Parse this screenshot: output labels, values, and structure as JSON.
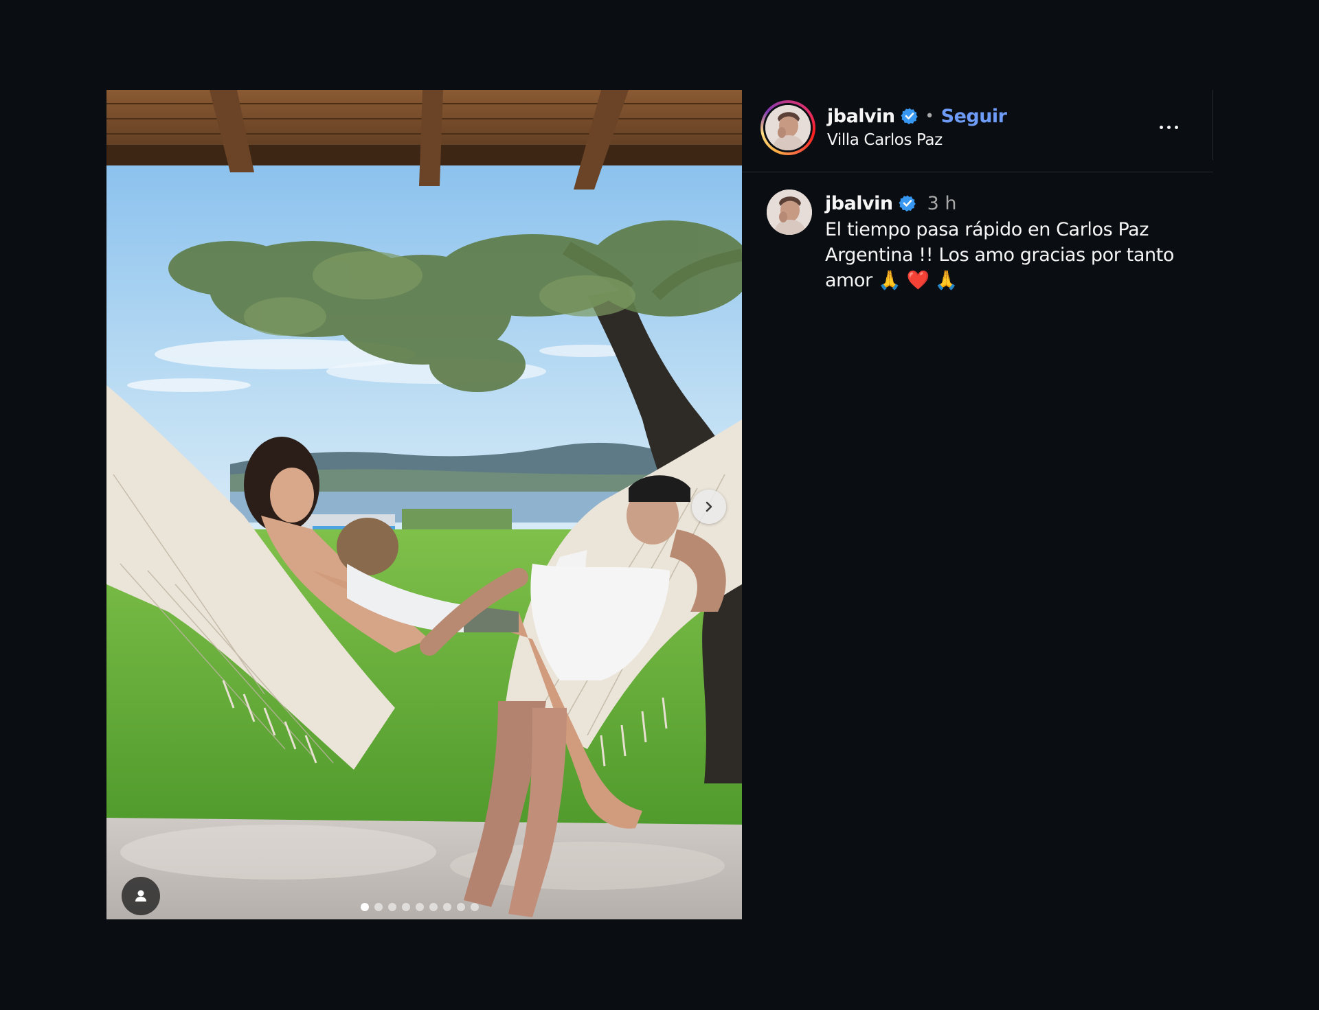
{
  "post": {
    "username": "jbalvin",
    "verified": true,
    "follow_label": "Seguir",
    "separator": "•",
    "location": "Villa Carlos Paz",
    "more_icon": "more-horizontal-icon"
  },
  "comment": {
    "username": "jbalvin",
    "time": "3 h",
    "caption": "El tiempo pasa rápido en Carlos Paz\nArgentina !! Los amo gracias por tanto\namor 🙏 ❤️ 🙏"
  },
  "media": {
    "total_slides": 9,
    "current_slide": 1,
    "next_icon": "chevron-right-icon",
    "tag_icon": "user-tag-icon"
  },
  "colors": {
    "background": "#0a0e13",
    "follow": "#6d9bf5",
    "verified": "#3897f0",
    "muted": "#a8a8a8"
  }
}
